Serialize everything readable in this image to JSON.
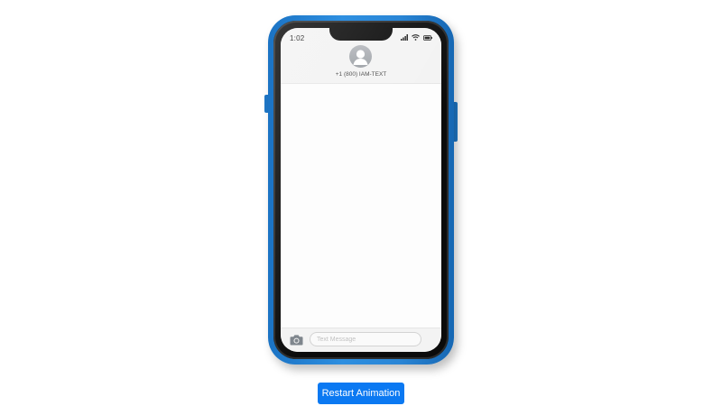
{
  "phone": {
    "status_time": "1:02",
    "contact_name": "+1 (800) IAM-TEXT",
    "compose_placeholder": "Text Message"
  },
  "controls": {
    "restart_label": "Restart Animation"
  },
  "icons": {
    "signal": "signal-bars-icon",
    "wifi": "wifi-icon",
    "battery": "battery-icon",
    "avatar": "contact-avatar-icon",
    "camera": "camera-icon"
  },
  "colors": {
    "case_blue": "#2a86d6",
    "button_blue": "#0b79f2",
    "screen_bg": "#fdfdfd"
  }
}
